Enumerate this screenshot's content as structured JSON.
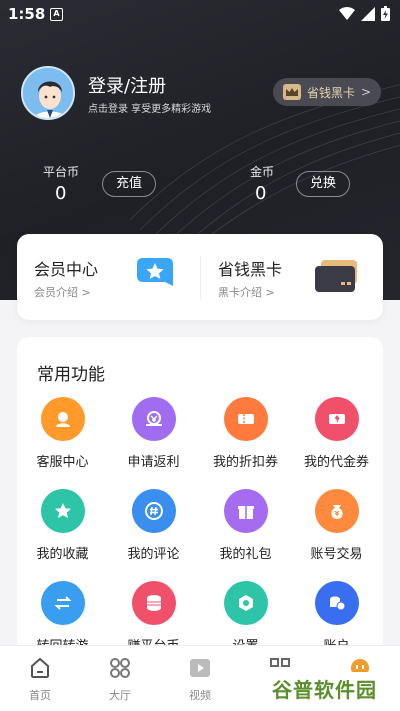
{
  "status": {
    "time": "1:58",
    "notif": "A"
  },
  "profile": {
    "title": "登录/注册",
    "subtitle": "点击登录 享受更多精彩游戏"
  },
  "vip_pill": {
    "label": "省钱黑卡",
    "chevron": ">"
  },
  "wallet": {
    "platform_coin": {
      "label": "平台币",
      "value": "0",
      "button": "充值"
    },
    "gold_coin": {
      "label": "金币",
      "value": "0",
      "button": "兑换"
    }
  },
  "cards": {
    "member": {
      "title": "会员中心",
      "sub": "会员介绍 >"
    },
    "blackcard": {
      "title": "省钱黑卡",
      "sub": "黑卡介绍 >"
    }
  },
  "functions": {
    "title": "常用功能",
    "items": [
      {
        "label": "客服中心",
        "color": "#ff9a2b",
        "icon": "headset-icon"
      },
      {
        "label": "申请返利",
        "color": "#a06cf0",
        "icon": "rebate-icon"
      },
      {
        "label": "我的折扣券",
        "color": "#ff7a3d",
        "icon": "coupon-icon"
      },
      {
        "label": "我的代金券",
        "color": "#f0506a",
        "icon": "voucher-icon"
      },
      {
        "label": "我的收藏",
        "color": "#2ec4a7",
        "icon": "star-icon"
      },
      {
        "label": "我的评论",
        "color": "#3a8ef0",
        "icon": "comment-icon"
      },
      {
        "label": "我的礼包",
        "color": "#a66cf0",
        "icon": "gift-icon"
      },
      {
        "label": "账号交易",
        "color": "#ff8a3d",
        "icon": "moneybag-icon"
      },
      {
        "label": "转回转游",
        "color": "#3a9ef0",
        "icon": "swap-icon"
      },
      {
        "label": "赚平台币",
        "color": "#f0506a",
        "icon": "coins-icon"
      },
      {
        "label": "设置",
        "color": "#2ec4a7",
        "icon": "settings-icon"
      },
      {
        "label": "账户",
        "color": "#3a6ef0",
        "icon": "wallet-icon"
      }
    ]
  },
  "tabs": [
    {
      "label": "首页",
      "icon": "home-icon"
    },
    {
      "label": "大厅",
      "icon": "grid-icon"
    },
    {
      "label": "视频",
      "icon": "video-icon"
    },
    {
      "label": "",
      "icon": "apps-icon"
    },
    {
      "label": "",
      "icon": "profile-icon"
    }
  ],
  "watermark": "谷普软件园"
}
